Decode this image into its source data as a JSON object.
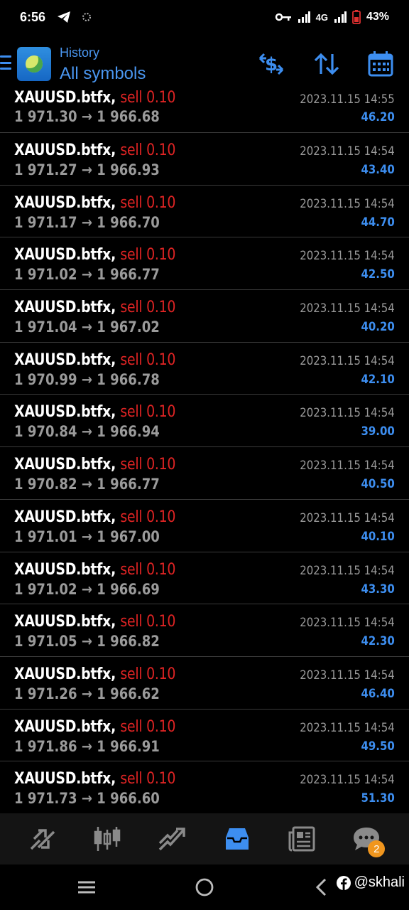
{
  "status_bar": {
    "time": "6:56",
    "network": "4G",
    "battery": "43%"
  },
  "header": {
    "subtitle": "History",
    "title": "All symbols"
  },
  "trades": [
    {
      "symbol": "XAUUSD.btfx,",
      "side": "sell 0.10",
      "open": "1 971.30",
      "close": "1 966.68",
      "time": "2023.11.15 14:55",
      "profit": "46.20"
    },
    {
      "symbol": "XAUUSD.btfx,",
      "side": "sell 0.10",
      "open": "1 971.27",
      "close": "1 966.93",
      "time": "2023.11.15 14:54",
      "profit": "43.40"
    },
    {
      "symbol": "XAUUSD.btfx,",
      "side": "sell 0.10",
      "open": "1 971.17",
      "close": "1 966.70",
      "time": "2023.11.15 14:54",
      "profit": "44.70"
    },
    {
      "symbol": "XAUUSD.btfx,",
      "side": "sell 0.10",
      "open": "1 971.02",
      "close": "1 966.77",
      "time": "2023.11.15 14:54",
      "profit": "42.50"
    },
    {
      "symbol": "XAUUSD.btfx,",
      "side": "sell 0.10",
      "open": "1 971.04",
      "close": "1 967.02",
      "time": "2023.11.15 14:54",
      "profit": "40.20"
    },
    {
      "symbol": "XAUUSD.btfx,",
      "side": "sell 0.10",
      "open": "1 970.99",
      "close": "1 966.78",
      "time": "2023.11.15 14:54",
      "profit": "42.10"
    },
    {
      "symbol": "XAUUSD.btfx,",
      "side": "sell 0.10",
      "open": "1 970.84",
      "close": "1 966.94",
      "time": "2023.11.15 14:54",
      "profit": "39.00"
    },
    {
      "symbol": "XAUUSD.btfx,",
      "side": "sell 0.10",
      "open": "1 970.82",
      "close": "1 966.77",
      "time": "2023.11.15 14:54",
      "profit": "40.50"
    },
    {
      "symbol": "XAUUSD.btfx,",
      "side": "sell 0.10",
      "open": "1 971.01",
      "close": "1 967.00",
      "time": "2023.11.15 14:54",
      "profit": "40.10"
    },
    {
      "symbol": "XAUUSD.btfx,",
      "side": "sell 0.10",
      "open": "1 971.02",
      "close": "1 966.69",
      "time": "2023.11.15 14:54",
      "profit": "43.30"
    },
    {
      "symbol": "XAUUSD.btfx,",
      "side": "sell 0.10",
      "open": "1 971.05",
      "close": "1 966.82",
      "time": "2023.11.15 14:54",
      "profit": "42.30"
    },
    {
      "symbol": "XAUUSD.btfx,",
      "side": "sell 0.10",
      "open": "1 971.26",
      "close": "1 966.62",
      "time": "2023.11.15 14:54",
      "profit": "46.40"
    },
    {
      "symbol": "XAUUSD.btfx,",
      "side": "sell 0.10",
      "open": "1 971.86",
      "close": "1 966.91",
      "time": "2023.11.15 14:54",
      "profit": "49.50"
    },
    {
      "symbol": "XAUUSD.btfx,",
      "side": "sell 0.10",
      "open": "1 971.73",
      "close": "1 966.60",
      "time": "2023.11.15 14:54",
      "profit": "51.30"
    }
  ],
  "arrow": "→",
  "bottom_nav": {
    "items": [
      "quotes-icon",
      "chart-icon",
      "trade-icon",
      "history-icon",
      "news-icon",
      "chat-icon"
    ],
    "active": "history-icon",
    "chat_badge": "2"
  },
  "watermark": "@skhali",
  "colors": {
    "accent": "#3d8ef0",
    "sell": "#e02424",
    "badge": "#f0961e"
  }
}
